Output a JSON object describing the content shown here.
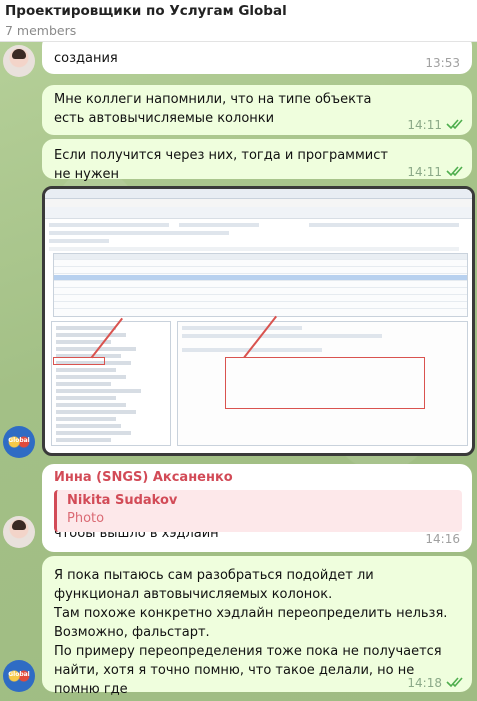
{
  "header": {
    "title": "Проектировщики по Услугам Global",
    "members": "7 members"
  },
  "messages": [
    {
      "id": "m1",
      "text": "создания",
      "time": "13:53"
    },
    {
      "id": "m2",
      "text": "Мне коллеги напомнили, что на типе объекта есть автовычисляемые колонки",
      "time": "14:11"
    },
    {
      "id": "m3",
      "text": "Если получится через них, тогда и программист не нужен",
      "time": "14:11"
    },
    {
      "id": "m4",
      "sender": "Инна (SNGS) Аксаненко",
      "reply_name": "Nikita Sudakov",
      "reply_label": "Photo",
      "text": "Немного не поняла, что мне нужно сделать с атрибутами, чтобы вышло в хэдлайн",
      "time": "14:16"
    },
    {
      "id": "m5",
      "text": "Я пока пытаюсь сам разобраться подойдет ли функционал автовычисляемых колонок.\nТам похоже конкретно хэдлайн переопределить нельзя. Возможно, фальстарт.\nПо примеру переопределения тоже пока не получается найти, хотя я точно помню, что такое делали, но не помню где",
      "time": "14:18"
    }
  ],
  "avatars": {
    "logo_text": "Global"
  },
  "colors": {
    "outgoing_bubble": "#effedd",
    "incoming_bubble": "#ffffff",
    "accent_red": "#d24b57",
    "check_green": "#4fae4e"
  }
}
